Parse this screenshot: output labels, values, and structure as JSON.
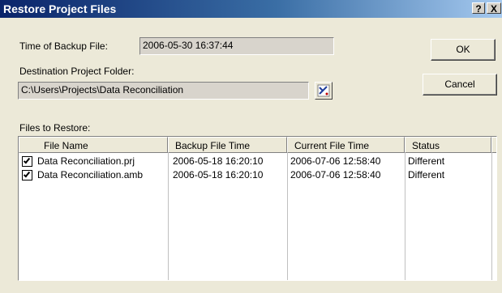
{
  "window": {
    "title": "Restore Project Files",
    "help_label": "?",
    "close_label": "X"
  },
  "backup_time": {
    "label": "Time of Backup File:",
    "value": "2006-05-30 16:37:44"
  },
  "destination": {
    "label": "Destination Project Folder:",
    "value": "C:\\Users\\Projects\\Data Reconciliation",
    "browse_icon": "folder-browse-icon"
  },
  "buttons": {
    "ok": "OK",
    "cancel": "Cancel"
  },
  "files": {
    "label": "Files to Restore:",
    "columns": [
      "File Name",
      "Backup File Time",
      "Current File Time",
      "Status"
    ],
    "rows": [
      {
        "checked": true,
        "name": "Data Reconciliation.prj",
        "backup_time": "2006-05-18 16:20:10",
        "current_time": "2006-07-06 12:58:40",
        "status": "Different"
      },
      {
        "checked": true,
        "name": "Data Reconciliation.amb",
        "backup_time": "2006-05-18 16:20:10",
        "current_time": "2006-07-06 12:58:40",
        "status": "Different"
      }
    ]
  },
  "colors": {
    "titlebar_start": "#0a246a",
    "titlebar_end": "#a6caf0",
    "dialog_face": "#ece9d8"
  }
}
